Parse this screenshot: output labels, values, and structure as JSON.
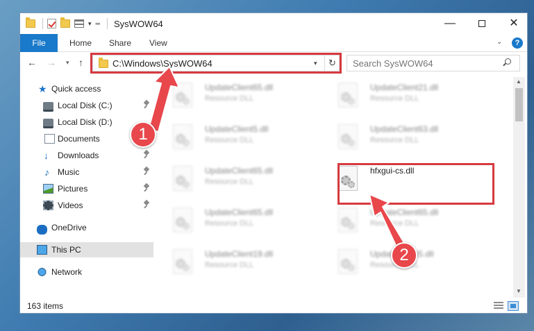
{
  "window": {
    "title": "SysWOW64",
    "controls": {
      "minimize": "—",
      "maximize": "",
      "close": "✕"
    }
  },
  "ribbon": {
    "tabs": [
      "File",
      "Home",
      "Share",
      "View"
    ],
    "help": "?",
    "chevron": "⌄"
  },
  "navbar": {
    "address": "C:\\Windows\\SysWOW64",
    "search_placeholder": "Search SysWOW64"
  },
  "sidebar": {
    "items": [
      {
        "label": "Quick access",
        "icon": "star-icon",
        "pinned": false
      },
      {
        "label": "Local Disk (C:)",
        "icon": "drive-icon",
        "pinned": true
      },
      {
        "label": "Local Disk (D:)",
        "icon": "drive-icon",
        "pinned": false
      },
      {
        "label": "Documents",
        "icon": "document-icon",
        "pinned": true
      },
      {
        "label": "Downloads",
        "icon": "download-icon",
        "pinned": true
      },
      {
        "label": "Music",
        "icon": "music-icon",
        "pinned": true
      },
      {
        "label": "Pictures",
        "icon": "pictures-icon",
        "pinned": true
      },
      {
        "label": "Videos",
        "icon": "videos-icon",
        "pinned": true
      },
      {
        "label": "OneDrive",
        "icon": "cloud-icon",
        "pinned": false
      },
      {
        "label": "This PC",
        "icon": "computer-icon",
        "pinned": false,
        "selected": true
      },
      {
        "label": "Network",
        "icon": "network-icon",
        "pinned": false
      }
    ]
  },
  "files": [
    {
      "name": "UpdateClient65.dll",
      "type": "Resource DLL",
      "blurred": true
    },
    {
      "name": "UpdateClient21.dll",
      "type": "Resource DLL",
      "blurred": true
    },
    {
      "name": "UpdateClient5.dll",
      "type": "Resource DLL",
      "blurred": true
    },
    {
      "name": "UpdateClient63.dll",
      "type": "Resource DLL",
      "blurred": true
    },
    {
      "name": "UpdateClient65.dll",
      "type": "Resource DLL",
      "blurred": true
    },
    {
      "name": "hfxgui-cs.dll",
      "type": "",
      "blurred": false
    },
    {
      "name": "UpdateClient65.dll",
      "type": "Resource DLL",
      "blurred": true
    },
    {
      "name": "UpdateClient65.dll",
      "type": "Resource DLL",
      "blurred": true
    },
    {
      "name": "UpdateClient19.dll",
      "type": "Resource DLL",
      "blurred": true
    },
    {
      "name": "UpdateClient5.dll",
      "type": "Resource DLL",
      "blurred": true
    }
  ],
  "status": {
    "item_count": "163 items"
  },
  "annotations": {
    "step1": "1",
    "step2": "2",
    "color": "#e8474c",
    "highlight_color": "#d6393f"
  }
}
